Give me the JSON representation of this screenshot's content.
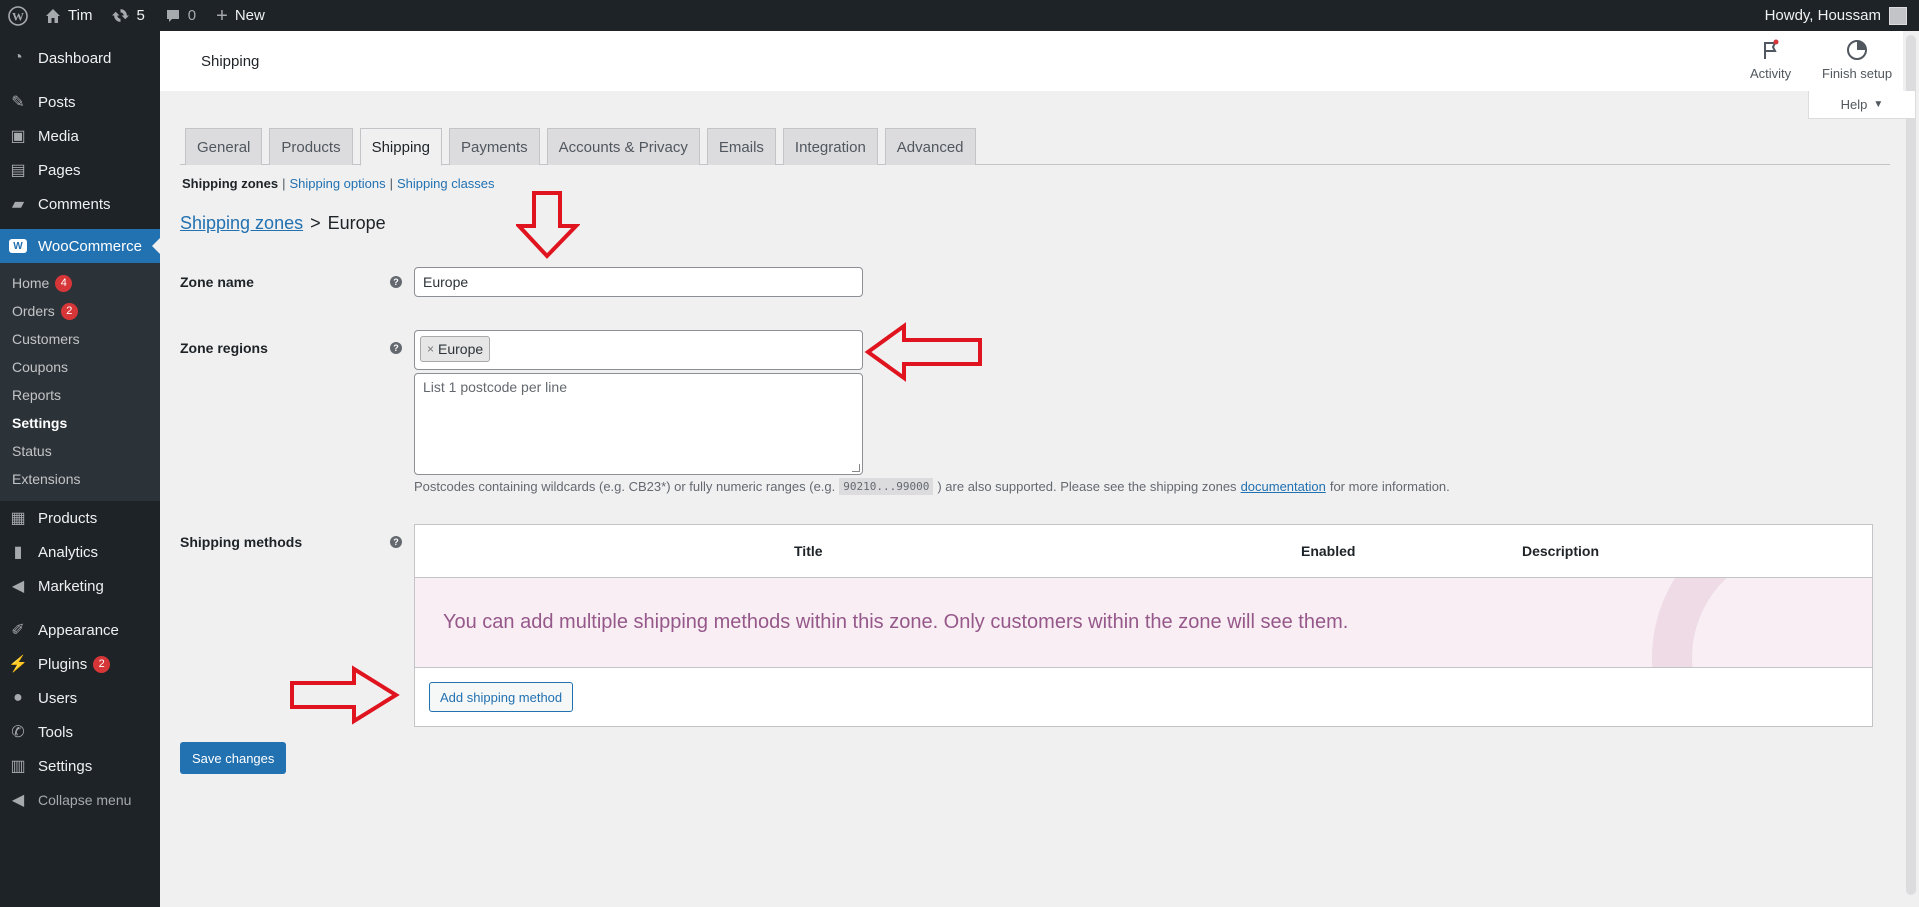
{
  "adminbar": {
    "site_name": "Tim",
    "updates_count": "5",
    "comments_count": "0",
    "new_label": "New",
    "greeting": "Howdy, Houssam"
  },
  "sidebar": {
    "dashboard": "Dashboard",
    "posts": "Posts",
    "media": "Media",
    "pages": "Pages",
    "comments": "Comments",
    "woocommerce": "WooCommerce",
    "woo_sub": [
      {
        "label": "Home",
        "badge": "4"
      },
      {
        "label": "Orders",
        "badge": "2"
      },
      {
        "label": "Customers"
      },
      {
        "label": "Coupons"
      },
      {
        "label": "Reports"
      },
      {
        "label": "Settings"
      },
      {
        "label": "Status"
      },
      {
        "label": "Extensions"
      }
    ],
    "products": "Products",
    "analytics": "Analytics",
    "marketing": "Marketing",
    "appearance": "Appearance",
    "plugins": "Plugins",
    "plugins_badge": "2",
    "users": "Users",
    "tools": "Tools",
    "settings": "Settings",
    "collapse": "Collapse menu"
  },
  "header": {
    "title": "Shipping",
    "activity": "Activity",
    "finish_setup": "Finish setup",
    "help": "Help"
  },
  "tabs": [
    "General",
    "Products",
    "Shipping",
    "Payments",
    "Accounts & Privacy",
    "Emails",
    "Integration",
    "Advanced"
  ],
  "active_tab": "Shipping",
  "subsub": {
    "current": "Shipping zones",
    "options": "Shipping options",
    "classes": "Shipping classes"
  },
  "breadcrumb": {
    "link": "Shipping zones",
    "separator": ">",
    "current": "Europe"
  },
  "form": {
    "zone_name_label": "Zone name",
    "zone_name_value": "Europe",
    "zone_regions_label": "Zone regions",
    "region_chip": "Europe",
    "postcodes_placeholder": "List 1 postcode per line",
    "postcode_desc_1": "Postcodes containing wildcards (e.g. CB23*) or fully numeric ranges (e.g.",
    "postcode_code": "90210...99000",
    "postcode_desc_2": ") are also supported. Please see the shipping zones",
    "postcode_link": "documentation",
    "postcode_desc_3": "for more information.",
    "shipping_methods_label": "Shipping methods"
  },
  "methods_table": {
    "col_title": "Title",
    "col_enabled": "Enabled",
    "col_description": "Description",
    "blank_message": "You can add multiple shipping methods within this zone. Only customers within the zone will see them.",
    "add_button": "Add shipping method"
  },
  "save_button": "Save changes",
  "colors": {
    "admin_dark": "#1d2327",
    "accent": "#2271b1",
    "woo_purple": "#96588a",
    "annotation_red": "#e0141e"
  }
}
